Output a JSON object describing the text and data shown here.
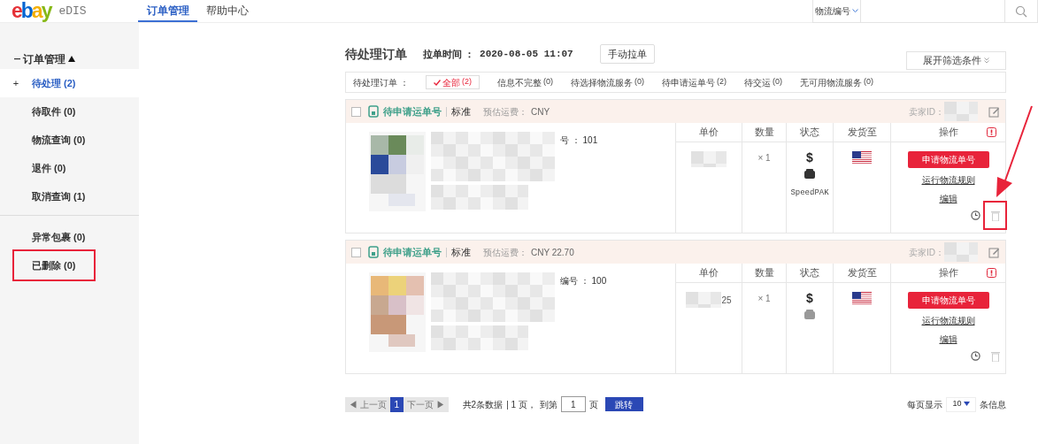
{
  "header": {
    "logo": "ebay",
    "product": "eDIS",
    "tabs": [
      {
        "label": "订单管理",
        "selected": true
      },
      {
        "label": "帮助中心",
        "selected": false
      }
    ],
    "search": {
      "type_label": "物流编号"
    }
  },
  "sidebar": {
    "group": {
      "label": "订单管理",
      "expanded": true
    },
    "sections": [
      [
        {
          "marker": "+",
          "label": "待处理",
          "count": "(2)",
          "selected": true,
          "annotated": false
        },
        {
          "label": "待取件",
          "count": "(0)",
          "selected": false,
          "annotated": false
        },
        {
          "label": "物流查询",
          "count": "(0)",
          "selected": false,
          "annotated": false
        },
        {
          "label": "退件",
          "count": "(0)",
          "selected": false,
          "annotated": false
        },
        {
          "label": "取消查询",
          "count": "(1)",
          "selected": false,
          "annotated": false
        }
      ],
      [
        {
          "label": "异常包裹",
          "count": "(0)",
          "selected": false,
          "annotated": false
        },
        {
          "label": "已删除",
          "count": "(0)",
          "selected": false,
          "annotated": true
        }
      ]
    ]
  },
  "page": {
    "title": "待处理订单",
    "pull_time_label": "拉单时间 ：",
    "pull_time": "2020-08-05 11:07",
    "pull_button": "手动拉单",
    "filter_button": "展开筛选条件"
  },
  "filter": {
    "label": "待处理订单 ：",
    "options": [
      {
        "label": "全部",
        "count": "(2)",
        "selected": true
      },
      {
        "label": "信息不完整",
        "count": "(0)",
        "selected": false
      },
      {
        "label": "待选择物流服务",
        "count": "(0)",
        "selected": false
      },
      {
        "label": "待申请运单号",
        "count": "(2)",
        "selected": false
      },
      {
        "label": "待交运",
        "count": "(0)",
        "selected": false
      },
      {
        "label": "无可用物流服务",
        "count": "(0)",
        "selected": false
      }
    ]
  },
  "orders": [
    {
      "checked": false,
      "status": "待申请运单号",
      "type": "标准",
      "fee_label": "预估运费：",
      "fee": "CNY",
      "seller_label": "卖家ID：",
      "item_no": "号 ： 101",
      "columns": [
        "单价",
        "数量",
        "状态",
        "发货至",
        "操作"
      ],
      "qty": "× 1",
      "currency": "$",
      "package_ready": true,
      "carrier": "SpeedPAK",
      "apply_button": "申请物流单号",
      "links": [
        "运行物流规则",
        "编辑"
      ],
      "trash_annotated": true
    },
    {
      "checked": false,
      "status": "待申请运单号",
      "type": "标准",
      "fee_label": "预估运费：",
      "fee": "CNY 22.70",
      "seller_label": "卖家ID：",
      "item_no": "编号 ： 100",
      "columns": [
        "单价",
        "数量",
        "状态",
        "发货至",
        "操作"
      ],
      "unit_price": "25",
      "qty": "× 1",
      "currency": "$",
      "package_ready": false,
      "apply_button": "申请物流单号",
      "links": [
        "运行物流规则",
        "编辑"
      ],
      "trash_annotated": false
    }
  ],
  "pagination": {
    "prev": "◀ 上一页",
    "pages": [
      {
        "label": "1",
        "selected": true
      }
    ],
    "next": "下一页 ▶",
    "total": "共2条数据",
    "pages_count": "| 1 页，",
    "goto_label": "到第",
    "goto_value": "1",
    "goto_unit": "页",
    "goto_button": "跳转",
    "per_page_label": "每页显示",
    "per_page": "10",
    "per_page_unit": "条信息"
  }
}
